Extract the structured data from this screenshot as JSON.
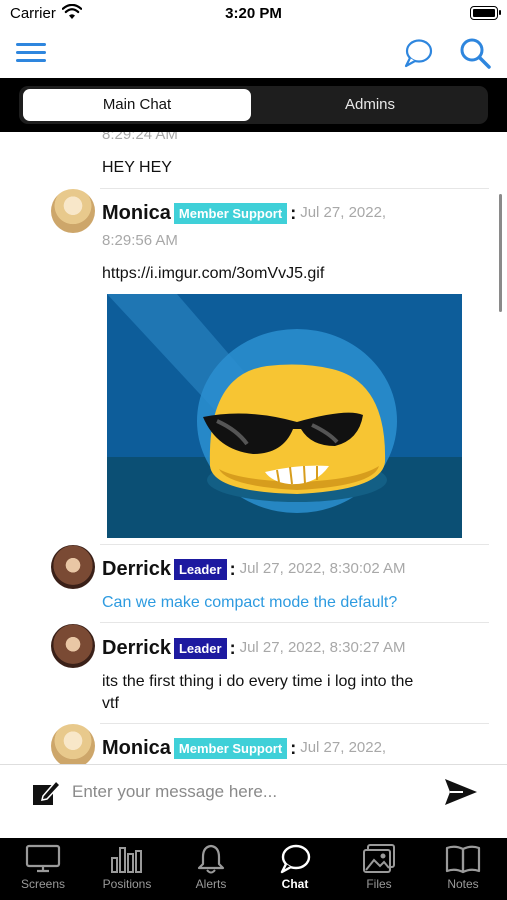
{
  "status_bar": {
    "carrier": "Carrier",
    "time": "3:20 PM"
  },
  "tabs_top": {
    "main": "Main Chat",
    "admins": "Admins",
    "active": "Main Chat"
  },
  "messages": {
    "top_partial": {
      "timestamp": "8:29:24 AM",
      "text": "HEY HEY"
    },
    "items": [
      {
        "author": "Monica",
        "role": "Member Support",
        "timestamp_date": "Jul 27, 2022,",
        "timestamp_time": "8:29:56 AM",
        "text": "https://i.imgur.com/3omVvJ5.gif",
        "has_image": true
      },
      {
        "author": "Derrick",
        "role": "Leader",
        "timestamp": "Jul 27, 2022, 8:30:02 AM",
        "text": "Can we make compact mode the default?",
        "text_is_link_color": true
      },
      {
        "author": "Derrick",
        "role": "Leader",
        "timestamp": "Jul 27, 2022, 8:30:27 AM",
        "text_line1": "its the first thing i do every time i log into the",
        "text_line2": "vtf"
      },
      {
        "author": "Monica",
        "role": "Member Support",
        "timestamp_date": "Jul 27, 2022,"
      }
    ]
  },
  "composer": {
    "placeholder": "Enter your message here..."
  },
  "tab_bar": [
    {
      "label": "Screens",
      "icon": "monitor-icon"
    },
    {
      "label": "Positions",
      "icon": "bar-chart-icon"
    },
    {
      "label": "Alerts",
      "icon": "bell-icon"
    },
    {
      "label": "Chat",
      "icon": "chat-bubble-icon",
      "active": true
    },
    {
      "label": "Files",
      "icon": "image-files-icon"
    },
    {
      "label": "Notes",
      "icon": "book-icon"
    }
  ],
  "colors": {
    "accent": "#2e86de",
    "link": "#2e9be0",
    "member_support_badge": "#3fd0d8",
    "leader_badge": "#1d1aa0"
  }
}
